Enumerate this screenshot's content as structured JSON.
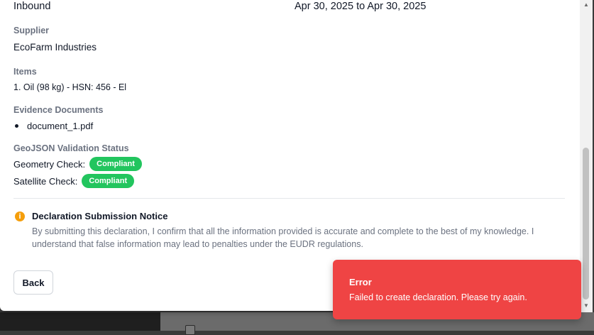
{
  "summary": {
    "direction": "Inbound",
    "date_range": "Apr 30, 2025 to Apr 30, 2025"
  },
  "supplier": {
    "label": "Supplier",
    "value": "EcoFarm Industries"
  },
  "items": {
    "label": "Items",
    "entries": [
      "1. Oil (98 kg) - HSN: 456 - El"
    ]
  },
  "evidence": {
    "label": "Evidence Documents",
    "documents": [
      "document_1.pdf"
    ]
  },
  "geojson": {
    "label": "GeoJSON Validation Status",
    "geometry": {
      "label": "Geometry Check:",
      "status": "Compliant"
    },
    "satellite": {
      "label": "Satellite Check:",
      "status": "Compliant"
    }
  },
  "notice": {
    "icon": "info-icon",
    "title": "Declaration Submission Notice",
    "body": "By submitting this declaration, I confirm that all the information provided is accurate and complete to the best of my knowledge. I understand that false information may lead to penalties under the EUDR regulations."
  },
  "actions": {
    "back_label": "Back"
  },
  "toast": {
    "title": "Error",
    "message": "Failed to create declaration. Please try again."
  },
  "colors": {
    "compliant": "#22c55e",
    "error": "#ef4444",
    "notice_icon": "#f59e0b"
  }
}
